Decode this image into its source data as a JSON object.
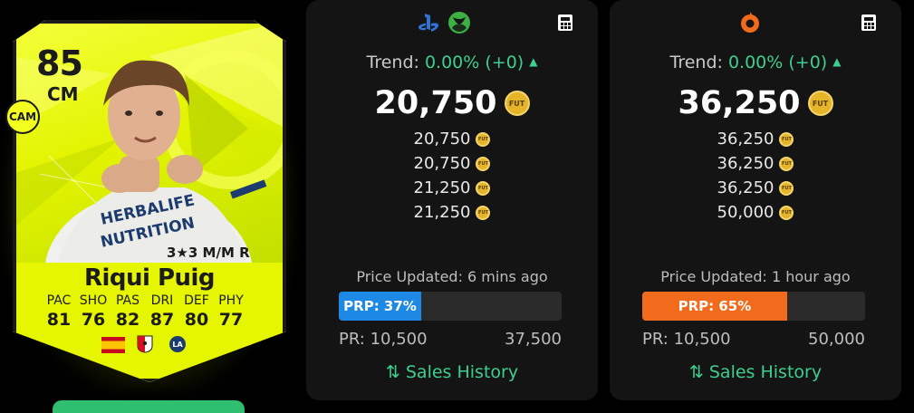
{
  "card": {
    "rating": "85",
    "position": "CM",
    "alt_position": "CAM",
    "skills": "3★3 M/M R",
    "name": "Riqui Puig",
    "shirt_text": "HERBALIFE NUTRITION",
    "stats": [
      {
        "label": "PAC",
        "value": "81"
      },
      {
        "label": "SHO",
        "value": "76"
      },
      {
        "label": "PAS",
        "value": "82"
      },
      {
        "label": "DRI",
        "value": "87"
      },
      {
        "label": "DEF",
        "value": "80"
      },
      {
        "label": "PHY",
        "value": "77"
      }
    ],
    "accent_color": "#e3f400"
  },
  "panels": [
    {
      "platforms": [
        "playstation-icon",
        "xbox-icon"
      ],
      "trend_label": "Trend:",
      "trend_value": "0.00% (+0)",
      "main_price": "20,750",
      "prices": [
        "20,750",
        "20,750",
        "21,250",
        "21,250"
      ],
      "updated": "Price Updated: 6 mins ago",
      "prp_label": "PRP: 37%",
      "prp_percent": 37,
      "prp_color": "#1e88e5",
      "range_min": "PR: 10,500",
      "range_max": "37,500",
      "sales_label": "Sales History"
    },
    {
      "platforms": [
        "origin-icon"
      ],
      "trend_label": "Trend:",
      "trend_value": "0.00% (+0)",
      "main_price": "36,250",
      "prices": [
        "36,250",
        "36,250",
        "36,250",
        "50,000"
      ],
      "updated": "Price Updated: 1 hour ago",
      "prp_label": "PRP: 65%",
      "prp_percent": 65,
      "prp_color": "#f26a1b",
      "range_min": "PR: 10,500",
      "range_max": "50,000",
      "sales_label": "Sales History"
    }
  ],
  "coin_text": "FUT"
}
